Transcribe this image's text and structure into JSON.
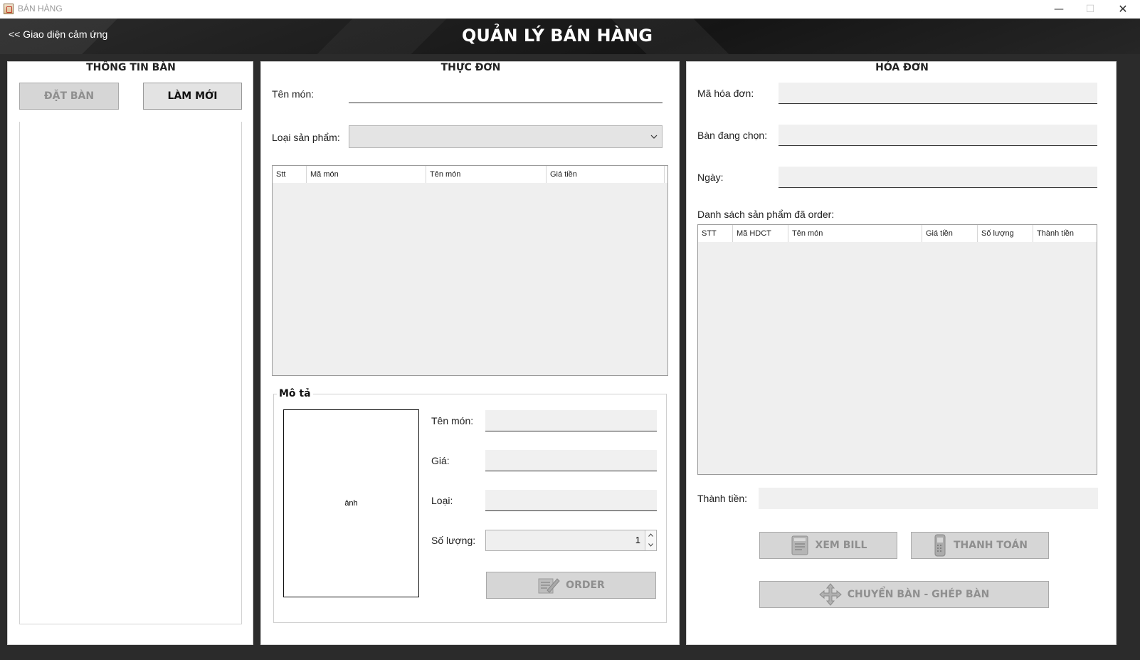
{
  "window": {
    "title": "BÁN HÀNG",
    "minimize": "—",
    "maximize": "☐",
    "close": "✕"
  },
  "header": {
    "back_link": "<< Giao diện cảm ứng",
    "title": "QUẢN LÝ BÁN HÀNG"
  },
  "tables_panel": {
    "legend": "THÔNG TIN BÀN",
    "book_button": "ĐẶT BÀN",
    "refresh_button": "LÀM MỚI"
  },
  "menu_panel": {
    "legend": "THỰC ĐƠN",
    "name_label": "Tên món:",
    "name_value": "",
    "category_label": "Loại sản phẩm:",
    "category_value": "",
    "columns": [
      "Stt",
      "Mã món",
      "Tên món",
      "Giá tiền"
    ],
    "description": {
      "legend": "Mô tả",
      "image_placeholder": "ảnh",
      "name_label": "Tên món:",
      "price_label": "Giá:",
      "type_label": "Loại:",
      "quantity_label": "Số lượng:",
      "quantity_value": "1",
      "order_button": "ORDER"
    }
  },
  "invoice_panel": {
    "legend": "HÓA ĐƠN",
    "invoice_id_label": "Mã hóa đơn:",
    "selected_table_label": "Bàn đang chọn:",
    "date_label": "Ngày:",
    "ordered_list_label": "Danh sách sản phẩm đã order:",
    "columns": [
      "STT",
      "Mã HDCT",
      "Tên món",
      "Giá tiền",
      "Số lượng",
      "Thành tiền"
    ],
    "total_label": "Thành tiền:",
    "view_bill_button": "XEM BILL",
    "pay_button": "THANH TOÁN",
    "move_merge_button": "CHUYỂN BÀN - GHÉP BÀN"
  },
  "colors": {
    "header_bg": "#1f1f1f",
    "main_bg": "#2b2b2b",
    "field_bg": "#f0f0f0",
    "disabled_button_bg": "#d6d6d6",
    "disabled_text": "#8f8f8f"
  },
  "icons": {
    "view_bill": "receipt-icon",
    "pay": "card-terminal-icon",
    "order": "order-edit-icon",
    "move": "move-arrows-icon"
  }
}
